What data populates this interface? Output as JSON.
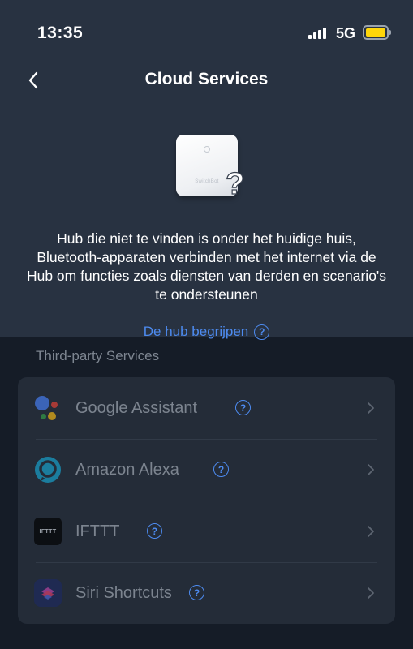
{
  "status_bar": {
    "time": "13:35",
    "network": "5G",
    "battery_color": "#ffd60a"
  },
  "header": {
    "title": "Cloud Services",
    "back_icon": "chevron-left-icon"
  },
  "hero": {
    "device_brand": "SwitchBot",
    "question_mark": "?",
    "description": "Hub die niet te vinden is onder het huidige huis, Bluetooth-apparaten verbinden met het internet via de Hub om functies zoals diensten van derden en scenario's te ondersteunen",
    "link_label": "De hub begrijpen"
  },
  "services": {
    "section_title": "Third-party Services",
    "items": [
      {
        "label": "Google Assistant",
        "icon": "google-assistant-icon"
      },
      {
        "label": "Amazon Alexa",
        "icon": "amazon-alexa-icon"
      },
      {
        "label": "IFTTT",
        "icon": "ifttt-icon",
        "icon_text": "IFTTT"
      },
      {
        "label": "Siri Shortcuts",
        "icon": "siri-shortcuts-icon"
      }
    ]
  },
  "colors": {
    "header_bg": "#283241",
    "page_bg": "#151c27",
    "card_bg": "#242c38",
    "accent": "#4d8bf0",
    "muted_text": "#7c848f"
  }
}
